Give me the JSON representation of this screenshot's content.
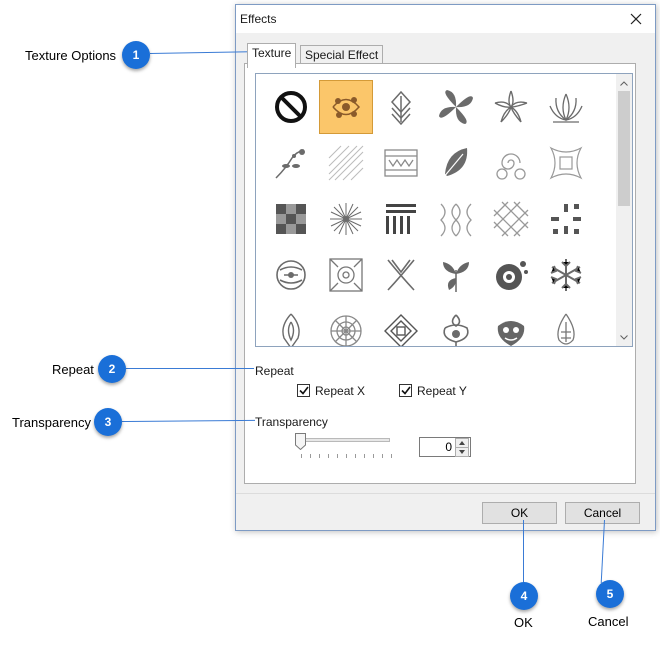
{
  "dialog": {
    "title": "Effects",
    "tabs": [
      {
        "label": "Texture",
        "active": true
      },
      {
        "label": "Special Effect",
        "active": false
      }
    ],
    "textures": {
      "selected_index": 1,
      "items": [
        "none-icon",
        "floral-swirl-icon",
        "arrow-chevron-icon",
        "four-leaf-icon",
        "flower-star-icon",
        "lotus-icon",
        "branch-flower-icon",
        "diagonal-lines-icon",
        "pattern-band-icon",
        "feather-icon",
        "spiral-icon",
        "square-frame-icon",
        "checker-icon",
        "starburst-icon",
        "stripes-icon",
        "diamond-chain-icon",
        "lattice-icon",
        "cross-dots-icon",
        "tribal-circle-icon",
        "ornate-tile-icon",
        "x-shape-icon",
        "leaf-sprig-icon",
        "eye-swirl-icon",
        "snowflake-icon",
        "rounded-diamond-icon",
        "mandala-icon",
        "square-diamond-icon",
        "baroque-icon",
        "crest-icon",
        "drop-ornament-icon"
      ]
    },
    "repeat": {
      "heading": "Repeat",
      "repeat_x": {
        "label": "Repeat X",
        "checked": true
      },
      "repeat_y": {
        "label": "Repeat Y",
        "checked": true
      }
    },
    "transparency": {
      "heading": "Transparency",
      "value": "0"
    },
    "buttons": {
      "ok": "OK",
      "cancel": "Cancel"
    }
  },
  "callouts": [
    {
      "number": "1",
      "text": "Texture Options"
    },
    {
      "number": "2",
      "text": "Repeat"
    },
    {
      "number": "3",
      "text": "Transparency"
    },
    {
      "number": "4",
      "text": "OK"
    },
    {
      "number": "5",
      "text": "Cancel"
    }
  ],
  "colors": {
    "accent": "#1a6fd8",
    "selection": "#fbc66a",
    "line": "#3a7bd5"
  }
}
